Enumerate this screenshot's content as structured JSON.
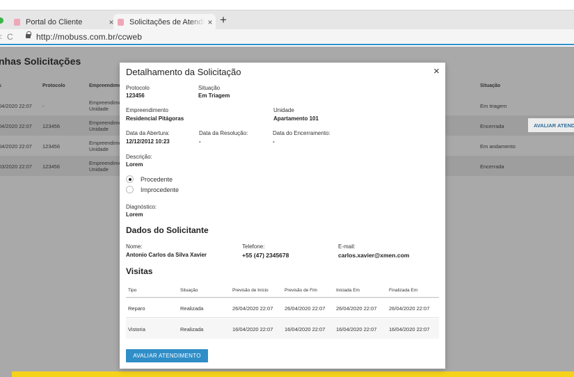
{
  "browser": {
    "tabs": [
      {
        "title": "Portal do Cliente",
        "close": "×"
      },
      {
        "title": "Solicitações de Atendimento",
        "close": "×"
      }
    ],
    "new_tab": "+",
    "url": "http://mobuss.com.br/ccweb",
    "reload_glyph": "C",
    "back_glyph": "<"
  },
  "page": {
    "title": "nhas Solicitações",
    "columns": [
      "s",
      "Protocolo",
      "Empreendimento",
      "Situação"
    ],
    "rows": [
      {
        "date": "04/2020 22:07",
        "protocol": "-",
        "empreendimento": "Empreendimento",
        "unidade": "Unidade",
        "situacao": "Em triagem"
      },
      {
        "date": "04/2020 22:07",
        "protocol": "123456",
        "empreendimento": "Empreendimento",
        "unidade": "Unidade",
        "situacao": "Encerrada"
      },
      {
        "date": "04/2020 22:07",
        "protocol": "123456",
        "empreendimento": "Empreendimento",
        "unidade": "Unidade",
        "situacao": "Em andamento"
      },
      {
        "date": "03/2020 22:07",
        "protocol": "123456",
        "empreendimento": "Empreendimento",
        "unidade": "Unidade",
        "situacao": "Encerrada"
      }
    ],
    "row_action": "AVALIAR ATENDIMENTO"
  },
  "modal": {
    "title": "Detalhamento da Solicitação",
    "close": "×",
    "protocolo_label": "Protocolo",
    "protocolo": "123456",
    "situacao_label": "Situação",
    "situacao": "Em Triagem",
    "empreendimento_label": "Empreendimento",
    "empreendimento": "Residencial Pitágoras",
    "unidade_label": "Unidade",
    "unidade": "Apartamento 101",
    "abertura_label": "Data da Abertura:",
    "abertura": "12/12/2012 10:23",
    "resolucao_label": "Data da Resolução:",
    "resolucao": "-",
    "encerramento_label": "Data do Encerramento:",
    "encerramento": "-",
    "descricao_label": "Descrição:",
    "descricao": "Lorem",
    "radio_procedente": "Procedente",
    "radio_improcedente": "Improcedente",
    "selected": "Procedente",
    "diagnostico_label": "Diagnóstico:",
    "diagnostico": "Lorem",
    "solicitante_title": "Dados do Solicitante",
    "nome_label": "Nome:",
    "nome": "Antonio Carlos da Silva Xavier",
    "telefone_label": "Telefone:",
    "telefone": "+55 (47) 2345678",
    "email_label": "E-mail:",
    "email": "carlos.xavier@xmen.com",
    "visitas_title": "Visitas",
    "visitas_columns": [
      "Tipo",
      "Situação",
      "Previsão de Início",
      "Previsão de Fim",
      "Iniciada Em",
      "Finalizada Em"
    ],
    "visitas": [
      {
        "tipo": "Reparo",
        "situacao": "Realizada",
        "inicio": "26/04/2020 22:07",
        "fim": "26/04/2020 22:07",
        "iniciada": "26/04/2020 22:07",
        "finalizada": "26/04/2020 22:07"
      },
      {
        "tipo": "Vistoria",
        "situacao": "Realizada",
        "inicio": "16/04/2020 22:07",
        "fim": "16/04/2020 22:07",
        "iniciada": "16/04/2020 22:07",
        "finalizada": "16/04/2020 22:07"
      }
    ],
    "button": "AVALIAR ATENDIMENTO"
  },
  "colors": {
    "accent": "#2f8ec8",
    "highlight_bar": "#f6d21b",
    "overlay_bg": "#a9a9a9"
  }
}
